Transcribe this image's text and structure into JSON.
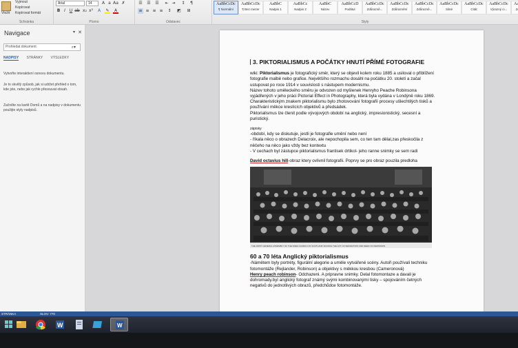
{
  "ribbon": {
    "clipboard": {
      "paste_label": "Vložit",
      "cut_label": "Vyjmout",
      "copy_label": "Kopírovat",
      "format_label": "Kopírovat formát",
      "group_label": "Schránka"
    },
    "font": {
      "name": "Arial",
      "size": "14",
      "group_label": "Písmo"
    },
    "paragraph": {
      "group_label": "Odstavec"
    },
    "styles": {
      "group_label": "Styly",
      "items": [
        {
          "sample": "AaBbCcDc",
          "name": "¶ Normální",
          "active": true
        },
        {
          "sample": "AaBbCcDc",
          "name": "¶ Bez mezer"
        },
        {
          "sample": "AaBbC",
          "name": "Nadpis 1"
        },
        {
          "sample": "AaBbCc",
          "name": "Nadpis 2"
        },
        {
          "sample": "AaBbC",
          "name": "Název"
        },
        {
          "sample": "AaBbCcD",
          "name": "Podtitul"
        },
        {
          "sample": "AaBbCcDc",
          "name": "Zdůrazně..."
        },
        {
          "sample": "AaBbCcDc",
          "name": "Zdůraznění"
        },
        {
          "sample": "AaBbCcDc",
          "name": "Zdůrazně..."
        },
        {
          "sample": "AaBbCcDc",
          "name": "Silné"
        },
        {
          "sample": "AaBbCcDc",
          "name": "Citát"
        },
        {
          "sample": "AaBbCcDc",
          "name": "Výrazný ci..."
        },
        {
          "sample": "AaBbCcDc",
          "name": "Zdůrazně..."
        }
      ]
    }
  },
  "nav": {
    "title": "Navigace",
    "search_placeholder": "Prohledat dokument",
    "tabs": [
      "NADPISY",
      "STRÁNKY",
      "VÝSLEDKY"
    ],
    "text1": "Vytvořte interaktivní osnovu dokumentu.",
    "text2": "Je to skvělý způsob, jak si udržet přehled o tom, kde jste, nebo jak rychle přesouvat obsah.",
    "text3": "Začněte na kartě Domů a na nadpisy v dokumentu použijte styly nadpisů."
  },
  "document": {
    "heading": "3. PIKTORIALISMUS A POČÁTKY HNUTÍ PŘÍMÉ FOTOGRAFIE",
    "intro_prefix": "wiki: ",
    "intro_bold": "Piktorialismus",
    "intro_rest": " je fotografický směr, který se objevil kolem roku 1885 a usiloval o přiblížení fotografie malbě nebo grafice. Největšího rozmachu dosáhl na počátku 20. století a začal ustupovat po roce 1914 v souvislosti s nástupem modernismu.",
    "intro2": "Název tohoto uměleckého směru je odvozen od myšlenek Henryho Peache Robinsona vyjádřených v jeho práci Pictorial Effect in Photography, která byla vydána v Londýně roku 1869. Charakteristickým znakem piktorialismu bylo zhotovování fotografií procesy ušlechtilých tisků a používání měkce kreslících objektivů a předsádek.",
    "intro3": "Piktorialismus lze členit podle vývojových období na anglický, impresionistický, secesní a puristický.",
    "notes_label": "zápisky",
    "note1": "-období, kdy se diskutuje, jestli je fotografie umění nebo není",
    "note2": "- říkala něco o obrazech Delacroix, ale nepochopila sem, co ten tam dělal,zas přeskočila z něčeho na něco jako vždy bez kontextu",
    "note3": "- V cechach byl zástupce piktorialismus frantisek drtikol- jeho ranne snimky se sem radi",
    "david_bold": "David octavius hill",
    "david_rest": "-obraz ktery ovlivnil fotografii. Poprvy se pro obraz pouzila predloha",
    "photo_caption": "THE FIRST GENERAL ASSEMBLY OF THE FREE CHURCH OF SCOTLAND SIGNING THE ACT OF SEPARATION AND DEED OF DEMISSION",
    "section2_heading": "60 a 70 léta Anglický piktorialismus",
    "s2_line1": "-Námětem byly portréty, figurální alegorie a uměle vytvářené scény. Autoři používali techniku fotomontáže (Rejlander, Robinson) a objektivy s měkkou kresbou (Cameronová)",
    "s2_bold": "Henry peach robinson",
    "s2_rest": "- Odchazeni. A pripravne snimky. Delal fotomontaze a davali je dohromady.byl anglický fotograf známý svými kombinovanými tisky – spojováním četných negativů do jednotlivých obrazů, předchůdce fotomontáže."
  },
  "statusbar": {
    "page": "STRÁNKA",
    "words": "SLOV: 770"
  },
  "colors": {
    "statusbar": "#2b5797",
    "accent": "#1f5fb3"
  }
}
